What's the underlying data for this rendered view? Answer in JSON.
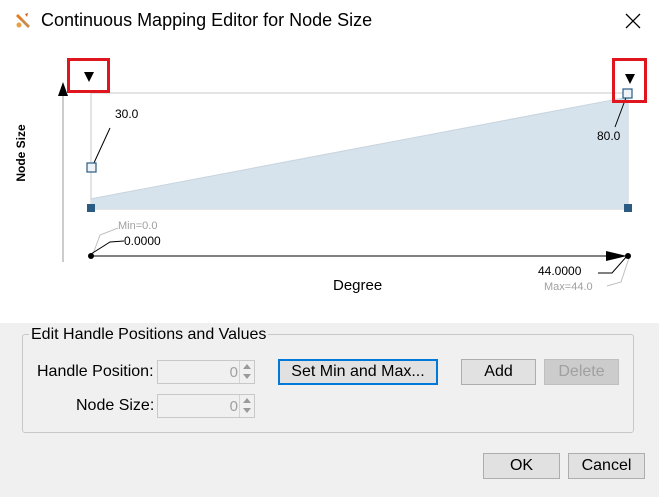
{
  "window": {
    "title": "Continuous Mapping Editor for Node Size",
    "app_icon": "cytoscape-icon",
    "close_icon": "close-icon"
  },
  "editor": {
    "y_axis_label": "Node Size",
    "x_axis_label": "Degree",
    "handles": [
      {
        "position": 0.0,
        "value": 30.0,
        "label": "30.0"
      },
      {
        "position": 44.0,
        "value": 80.0,
        "label": "80.0"
      }
    ],
    "x_range": [
      0.0,
      44.0
    ],
    "min_label": "Min=0.0",
    "max_label": "Max=44.0",
    "left_value_label": "0.0000",
    "right_value_label": "44.0000",
    "fill_color": "#d6e3ec",
    "highlight_color": "#e0161e",
    "handle_color": "#2b5a82"
  },
  "handle_editor": {
    "group_title": "Edit Handle Positions and Values",
    "handle_position_label": "Handle Position:",
    "handle_position_value": "0",
    "node_size_label": "Node Size:",
    "node_size_value": "0",
    "set_min_max_button": "Set Min and Max...",
    "add_button": "Add",
    "delete_button": "Delete"
  },
  "footer": {
    "ok_button": "OK",
    "cancel_button": "Cancel"
  }
}
